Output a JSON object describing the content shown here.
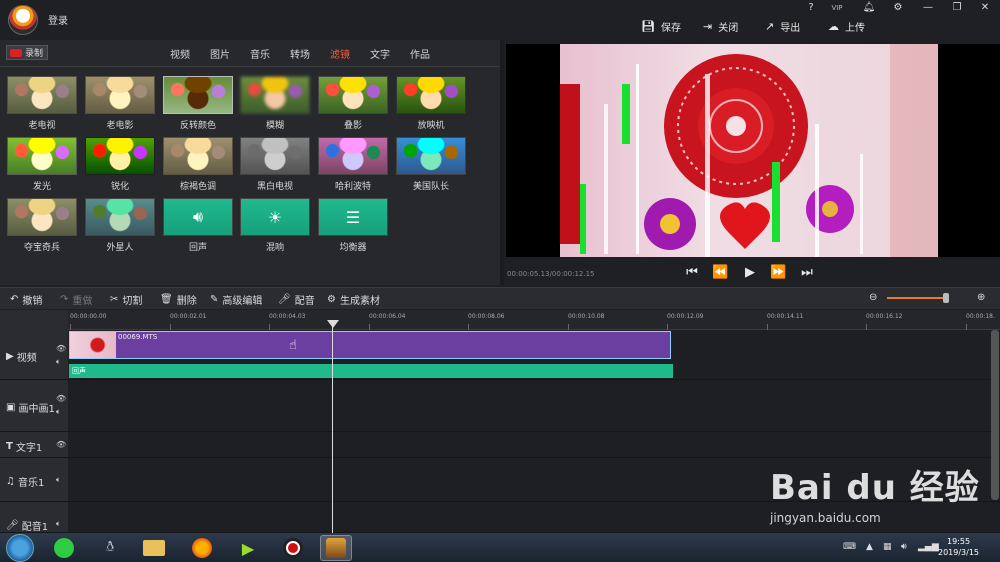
{
  "header": {
    "login": "登录",
    "top_icons": [
      "?",
      "VIP",
      "bell-icon",
      "gear-icon",
      "minimize-icon",
      "restore-icon",
      "close-icon"
    ],
    "save": "保存",
    "close": "关闭",
    "export": "导出",
    "upload": "上传"
  },
  "library": {
    "record": "录制",
    "tabs": [
      "视频",
      "图片",
      "音乐",
      "转场",
      "滤镜",
      "文字",
      "作品"
    ],
    "active_tab": "滤镜",
    "filters": [
      "老电视",
      "老电影",
      "反转颜色",
      "模糊",
      "叠影",
      "放映机",
      "发光",
      "锐化",
      "棕褐色调",
      "黑白电视",
      "哈利波特",
      "美国队长",
      "夺宝奇兵",
      "外星人",
      "回声",
      "混响",
      "均衡器"
    ]
  },
  "preview": {
    "timecode": "00:00:05.13/00:00:12.15"
  },
  "toolbar": {
    "undo": "撤销",
    "redo": "重做",
    "cut": "切割",
    "delete": "删除",
    "advanced": "高级编辑",
    "dub": "配音",
    "generate": "生成素材"
  },
  "ruler": [
    "00:00:00.00",
    "00:00:02.01",
    "00:00:04.03",
    "00:00:06.04",
    "00:00:08.06",
    "00:00:10.08",
    "00:00:12.09",
    "00:00:14.11",
    "00:00:16.12",
    "00:00:18."
  ],
  "tracks": {
    "video": "视频",
    "pip": "画中画1",
    "text": "文字1",
    "music": "音乐1",
    "dub": "配音1"
  },
  "timeline": {
    "clip_name": "00069.MTS",
    "fx_name": "回声"
  },
  "taskbar": {
    "time": "19:55",
    "date": "2019/3/15"
  },
  "watermark": {
    "brand": "Bai du 经验",
    "url": "jingyan.baidu.com"
  },
  "colors": {
    "accent": "#ff5a3c",
    "clip": "#6a3fa0",
    "fx": "#1fb98c"
  }
}
